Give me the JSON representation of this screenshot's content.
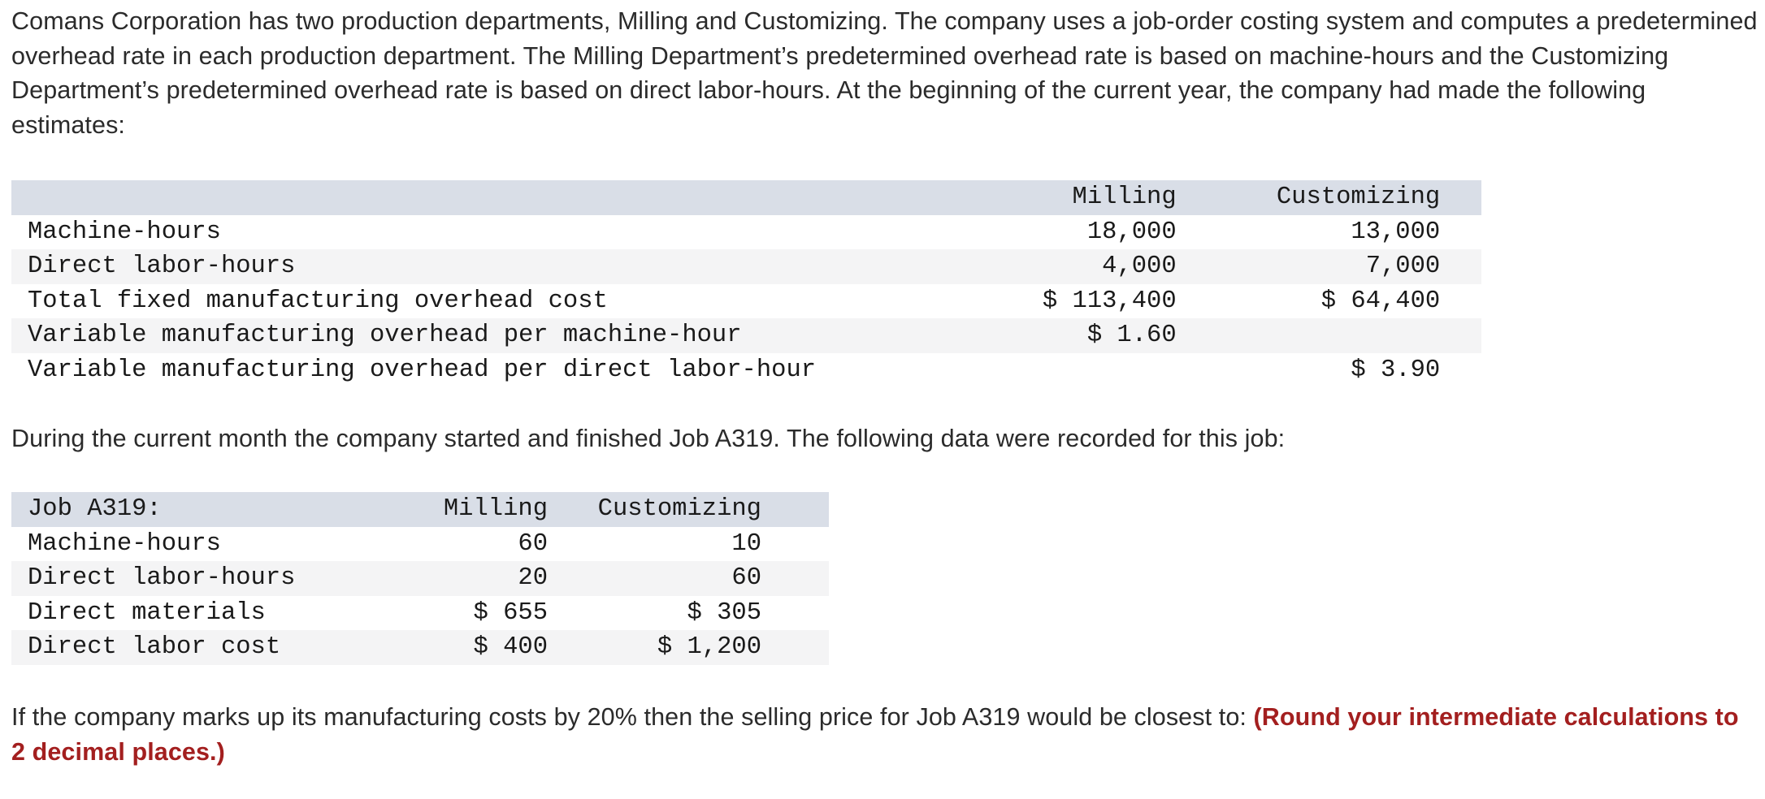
{
  "intro": "Comans Corporation has two production departments, Milling and Customizing. The company uses a job-order costing system and computes a predetermined overhead rate in each production department. The Milling Department’s predetermined overhead rate is based on machine-hours and the Customizing Department’s predetermined overhead rate is based on direct labor-hours. At the beginning of the current year, the company had made the following estimates:",
  "estimates": {
    "header": {
      "label": "",
      "milling": "Milling",
      "customizing": "Customizing"
    },
    "rows": [
      {
        "label": "Machine-hours",
        "milling": "18,000",
        "customizing": "13,000"
      },
      {
        "label": "Direct labor-hours",
        "milling": "4,000",
        "customizing": "7,000"
      },
      {
        "label": "Total fixed manufacturing overhead cost",
        "milling": "$ 113,400",
        "customizing": "$ 64,400"
      },
      {
        "label": "Variable manufacturing overhead per machine-hour",
        "milling": "$ 1.60",
        "customizing": ""
      },
      {
        "label": "Variable manufacturing overhead per direct labor-hour",
        "milling": "",
        "customizing": "$ 3.90"
      }
    ]
  },
  "during": "During the current month the company started and finished Job A319. The following data were recorded for this job:",
  "job": {
    "header": {
      "label": "Job A319:",
      "milling": "Milling",
      "customizing": "Customizing"
    },
    "rows": [
      {
        "label": "Machine-hours",
        "milling": "60",
        "customizing": "10"
      },
      {
        "label": "Direct labor-hours",
        "milling": "20",
        "customizing": "60"
      },
      {
        "label": "Direct materials",
        "milling": "$ 655",
        "customizing": "$ 305"
      },
      {
        "label": "Direct labor cost",
        "milling": "$ 400",
        "customizing": "$ 1,200"
      }
    ]
  },
  "question": {
    "text": "If the company marks up its manufacturing costs by 20% then the selling price for Job A319 would be closest to: ",
    "emphasis": "(Round your intermediate calculations to 2 decimal places.)"
  },
  "colors": {
    "header_row": "#d9dee7",
    "alt_row": "#f4f4f5",
    "emphasis": "#a31f1f"
  }
}
